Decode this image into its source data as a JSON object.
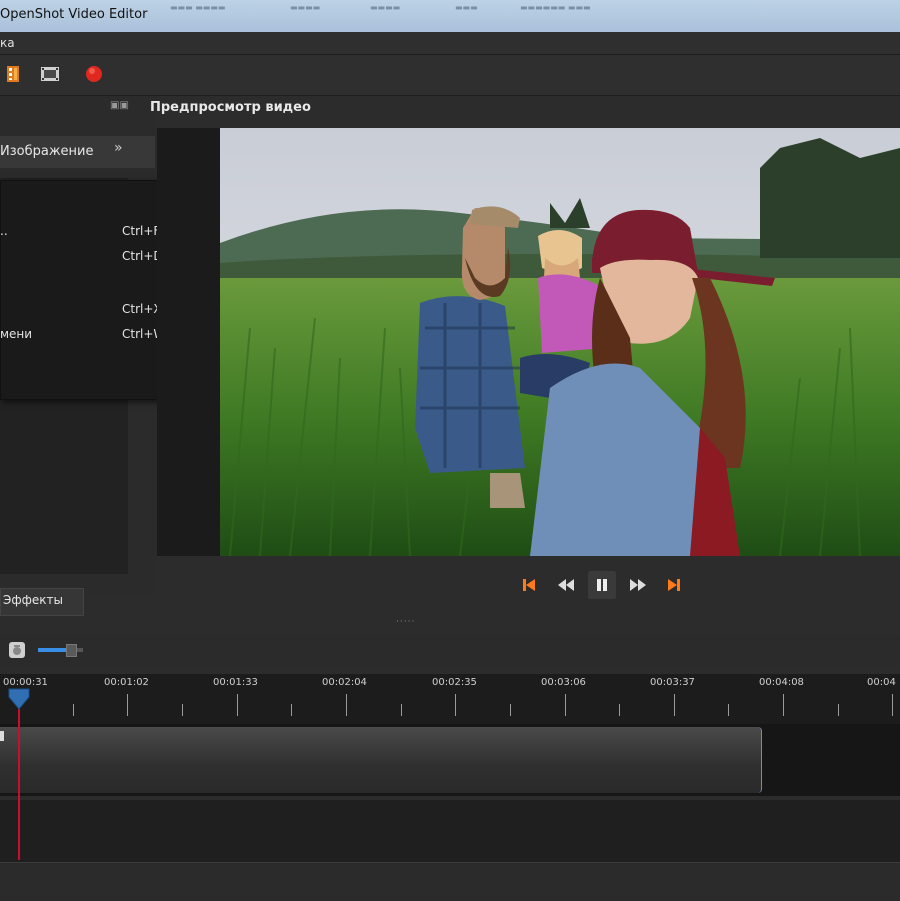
{
  "window": {
    "title": "OpenShot Video Editor"
  },
  "menu": {
    "visible_item": "ка"
  },
  "preview": {
    "title": "Предпросмотр видео"
  },
  "left_panel": {
    "tab_label": "Изображение",
    "more_tabs": "»"
  },
  "context_menu": {
    "items": [
      {
        "label": "..",
        "shortcut": "Ctrl+F"
      },
      {
        "label": "",
        "shortcut": "Ctrl+D"
      },
      {
        "label": "",
        "shortcut": "Ctrl+X"
      },
      {
        "label": "мени",
        "shortcut": "Ctrl+W"
      }
    ]
  },
  "bottom_tabs": {
    "effects": "Эффекты"
  },
  "timeline": {
    "zoom_fraction": 0.7,
    "playhead_time": "00:00:31",
    "ruler_labels": [
      "00:00:31",
      "00:01:02",
      "00:01:33",
      "00:02:04",
      "00:02:35",
      "00:03:06",
      "00:03:37",
      "00:04:08",
      "00:04"
    ]
  },
  "icons": {
    "toolbar": [
      "film-strip-icon",
      "export-film-icon",
      "record-icon"
    ],
    "transport": [
      "jump-start-icon",
      "rewind-icon",
      "pause-icon",
      "fast-forward-icon",
      "jump-end-icon"
    ]
  },
  "colors": {
    "accent_orange": "#ff7a1a",
    "playhead_red": "#c8102e",
    "playhead_blue": "#2f6fb2",
    "slider_blue": "#3a8ee6"
  }
}
